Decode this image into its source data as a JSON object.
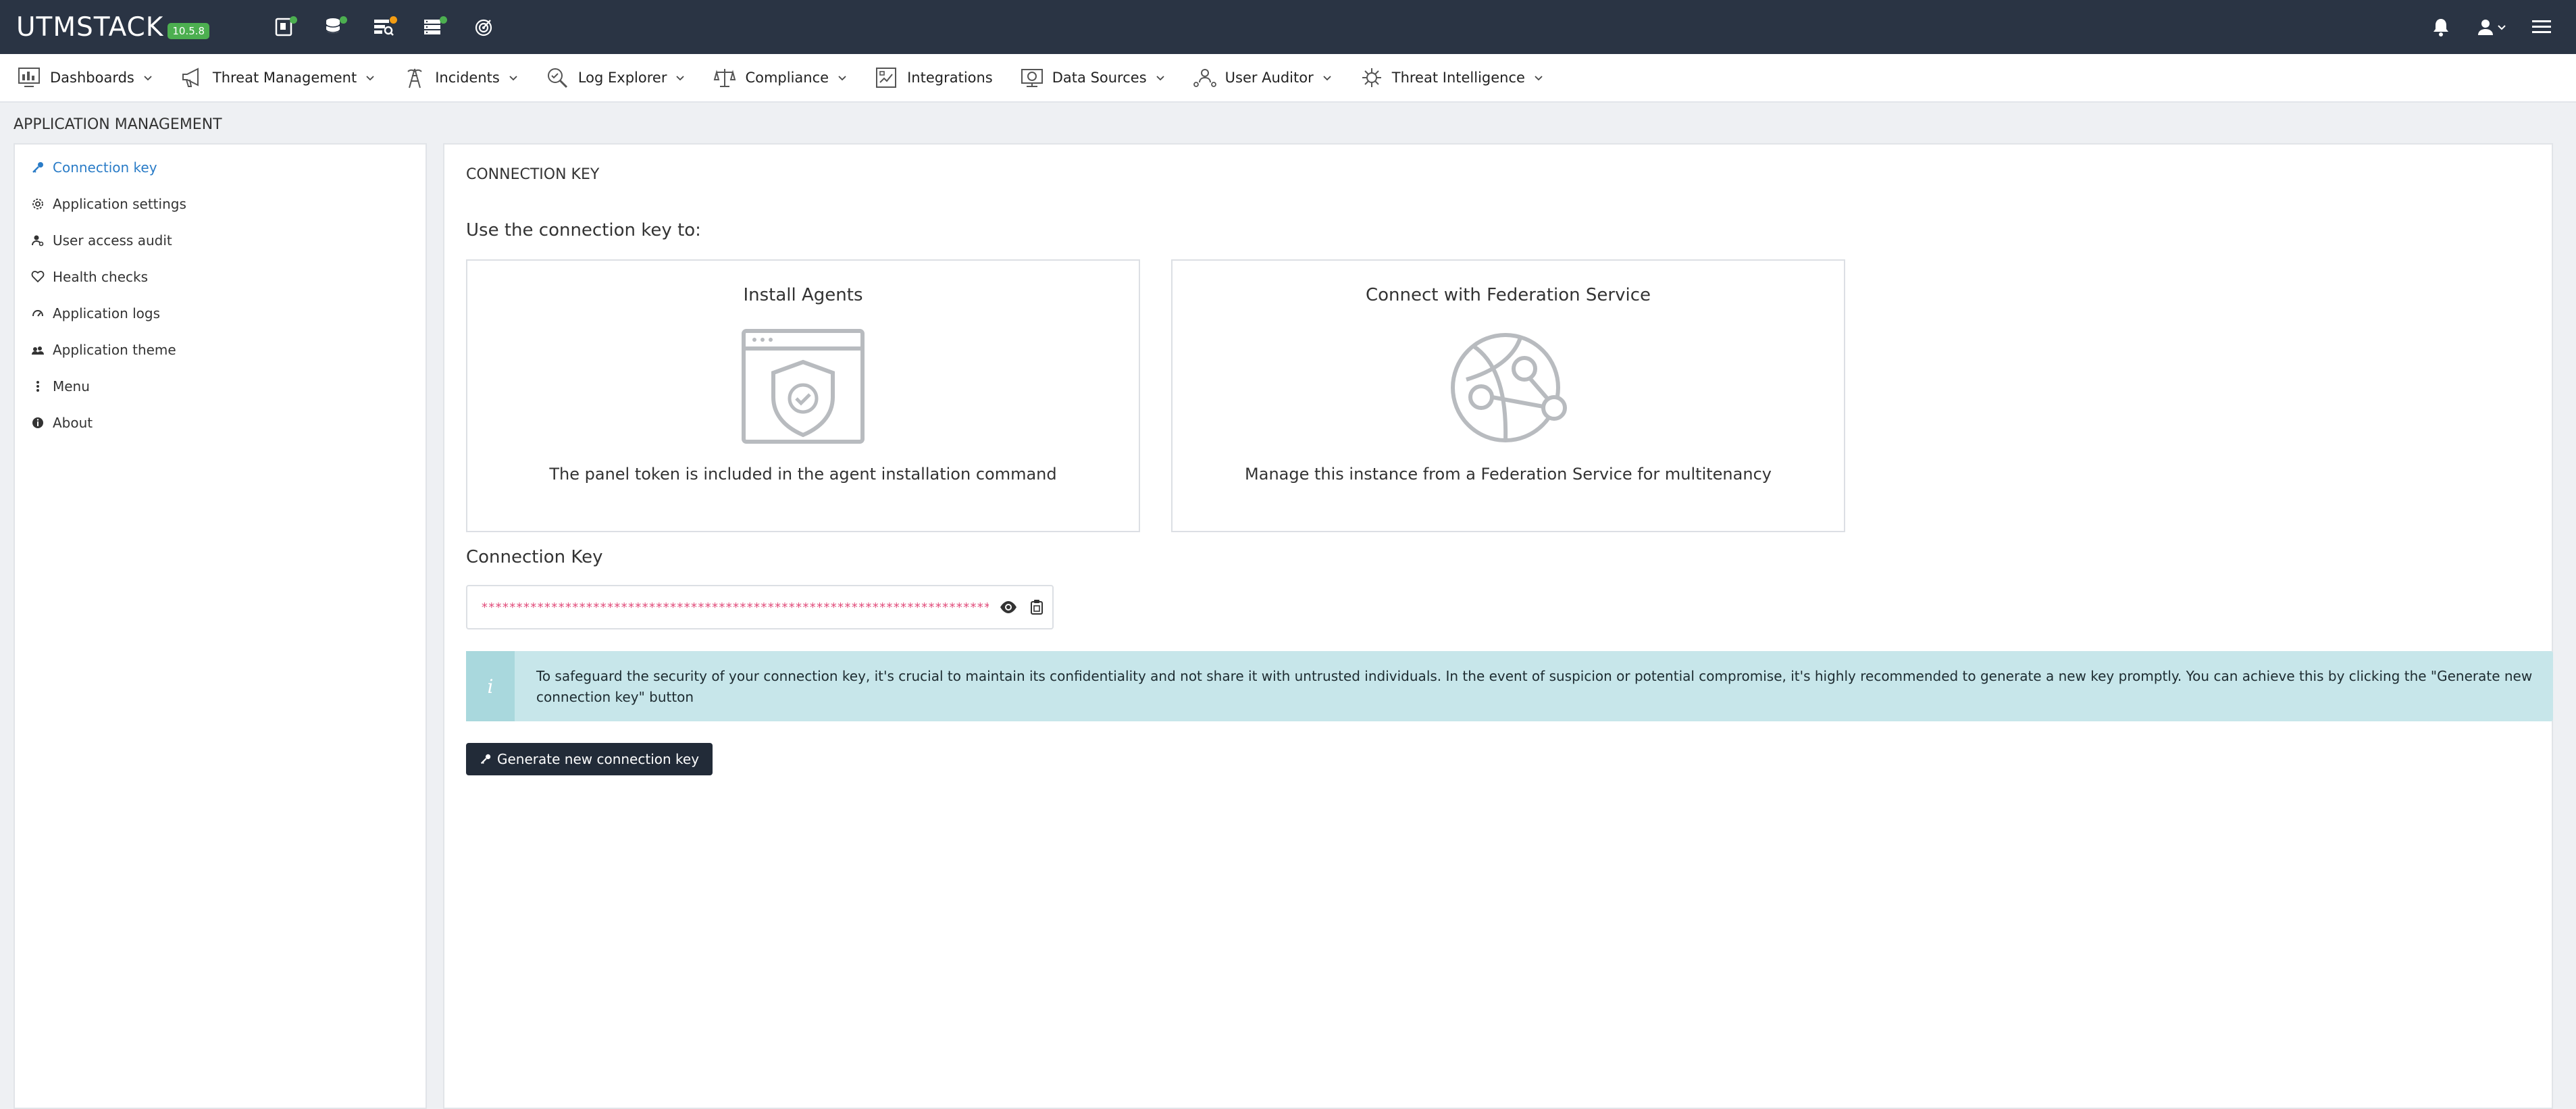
{
  "brand": {
    "name": "UTMSTACK",
    "version": "10.5.8"
  },
  "topbar": {
    "icons": [
      "agent-status-icon",
      "database-icon",
      "log-search-icon",
      "server-stack-icon",
      "radar-icon"
    ]
  },
  "nav": {
    "items": [
      {
        "label": "Dashboards",
        "icon": "dashboard-icon",
        "dropdown": true
      },
      {
        "label": "Threat Management",
        "icon": "megaphone-icon",
        "dropdown": true
      },
      {
        "label": "Incidents",
        "icon": "tower-icon",
        "dropdown": true
      },
      {
        "label": "Log Explorer",
        "icon": "search-icon",
        "dropdown": true
      },
      {
        "label": "Compliance",
        "icon": "scale-icon",
        "dropdown": true
      },
      {
        "label": "Integrations",
        "icon": "integration-icon",
        "dropdown": false
      },
      {
        "label": "Data Sources",
        "icon": "data-sources-icon",
        "dropdown": true
      },
      {
        "label": "User Auditor",
        "icon": "user-network-icon",
        "dropdown": true
      },
      {
        "label": "Threat Intelligence",
        "icon": "virus-icon",
        "dropdown": true
      }
    ]
  },
  "page": {
    "title": "APPLICATION MANAGEMENT"
  },
  "sidebar": {
    "items": [
      {
        "label": "Connection key",
        "icon": "key-icon",
        "active": true
      },
      {
        "label": "Application settings",
        "icon": "gear-icon",
        "active": false
      },
      {
        "label": "User access audit",
        "icon": "user-audit-icon",
        "active": false
      },
      {
        "label": "Health checks",
        "icon": "heart-icon",
        "active": false
      },
      {
        "label": "Application logs",
        "icon": "logs-icon",
        "active": false
      },
      {
        "label": "Application theme",
        "icon": "theme-icon",
        "active": false
      },
      {
        "label": "Menu",
        "icon": "vertical-dots-icon",
        "active": false
      },
      {
        "label": "About",
        "icon": "info-icon",
        "active": false
      }
    ]
  },
  "main": {
    "section_title": "CONNECTION KEY",
    "use_title": "Use the connection key to:",
    "cards": [
      {
        "title": "Install Agents",
        "description": "The panel token is included in the agent installation command",
        "icon": "shield-window-icon"
      },
      {
        "title": "Connect with Federation Service",
        "description": "Manage this instance from a Federation Service for multitenancy",
        "icon": "globe-network-icon"
      }
    ],
    "key_label": "Connection Key",
    "key_value": "***************************************************************************************",
    "alert_text": "To safeguard the security of your connection key, it's crucial to maintain its confidentiality and not share it with untrusted individuals. In the event of suspicion or potential compromise, it's highly recommended to generate a new key promptly. You can achieve this by clicking the \"Generate new connection key\" button",
    "alert_icon": "i",
    "generate_button": "Generate new connection key"
  },
  "colors": {
    "topbar": "#2a3444",
    "active_link": "#2a7cc7",
    "key_text": "#e14b7a",
    "alert_bg": "#c7e6ea",
    "button_bg": "#222b38",
    "status_green": "#4caf50",
    "status_orange": "#f39c12"
  }
}
